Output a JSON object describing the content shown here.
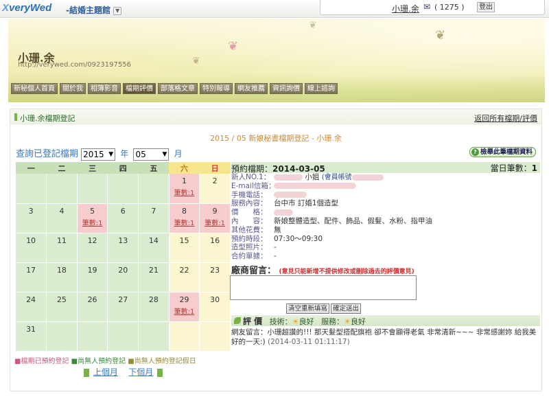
{
  "topbar": {
    "logo_x": "X",
    "logo_text": "veryWed",
    "site_menu": "-結婚主題館",
    "dropdown_glyph": "▼",
    "user_name": "小珊.余",
    "mail_glyph": "✉",
    "count": "( 1275 )",
    "logout": "登出"
  },
  "banner": {
    "title": "小珊.余",
    "url": "http://verywed.com/0923197556",
    "nav": [
      "新秘個人首頁",
      "關於我",
      "相簿影音",
      "檔期評價",
      "部落格文章",
      "特別報導",
      "網友推薦",
      "資訊詢價",
      "線上諮詢"
    ]
  },
  "panel": {
    "title": "小珊.余檔期登記",
    "back_link": "返回所有檔期/評價",
    "month_title": "2015 / 05 新娘秘書檔期登記 - 小珊.余",
    "query_label": "查詢已登記檔期",
    "year_value": "2015",
    "year_unit": "年",
    "month_value": "05",
    "month_unit": "月",
    "check_button": "檢舉此筆檔期資料",
    "check_icon": "?"
  },
  "calendar": {
    "weekdays": [
      "一",
      "二",
      "三",
      "四",
      "五",
      "六",
      "日"
    ],
    "count_label": "筆數:1",
    "rows": [
      [
        "",
        "",
        "",
        "",
        "",
        "1",
        "2"
      ],
      [
        "3",
        "4",
        "5",
        "6",
        "7",
        "8",
        "9"
      ],
      [
        "10",
        "11",
        "12",
        "13",
        "14",
        "15",
        "16"
      ],
      [
        "17",
        "18",
        "19",
        "20",
        "21",
        "22",
        "23"
      ],
      [
        "24",
        "25",
        "26",
        "27",
        "28",
        "29",
        "30"
      ],
      [
        "31",
        "",
        "",
        "",
        "",
        "",
        ""
      ]
    ]
  },
  "legend": {
    "booked": "■檔期已預約登記",
    "free": "■尚無人預約登記",
    "free_holiday": "■尚無人預約登記假日"
  },
  "pager": {
    "prev": "上個月",
    "next": "下個月"
  },
  "detail": {
    "date_label": "預約檔期：",
    "date_value": "2014-03-05",
    "daily_count_label": "當日筆數：",
    "daily_count_value": "1",
    "newcomer_label": "新人NO.1：",
    "newcomer_suffix": "小姐",
    "account_label": "(會員帳號",
    "email_label": "E-mail信箱：",
    "phone_label": "手機電話：",
    "service_label": "服務內容：",
    "service_value": "台中市 訂婚1個造型",
    "price_label": "價　　格：",
    "content_label": "內　　容：",
    "content_value": "新娘整體造型、配件、飾品、假髮、水粉、指甲油",
    "other_label": "其他花費：",
    "other_value": "無",
    "time_label": "預約時段：",
    "time_value": "07:30～09:30",
    "photo_label": "造型照片：",
    "photo_value": "-",
    "contract_label": "合約單據：",
    "contract_value": "-",
    "msg_title": "廠商留言：",
    "msg_note": "(意見只能新增不提供修改或刪除過去的評價意見)",
    "clear_button": "清空重新填寫",
    "submit_button": "確定送出",
    "review_label": "評 價",
    "skill_label": "技術：",
    "service_rating_label": "服務：",
    "rating_good": "良好",
    "sun_glyph": "☀",
    "review_text": "網友留言：小珊超讚的!!! 那天髮型搭配旗袍 卻不會顯得老氣 非常清新~~~ 非常感謝妳 給我美好的一天:)",
    "review_time": "(2014-03-11 01:11:17)"
  }
}
